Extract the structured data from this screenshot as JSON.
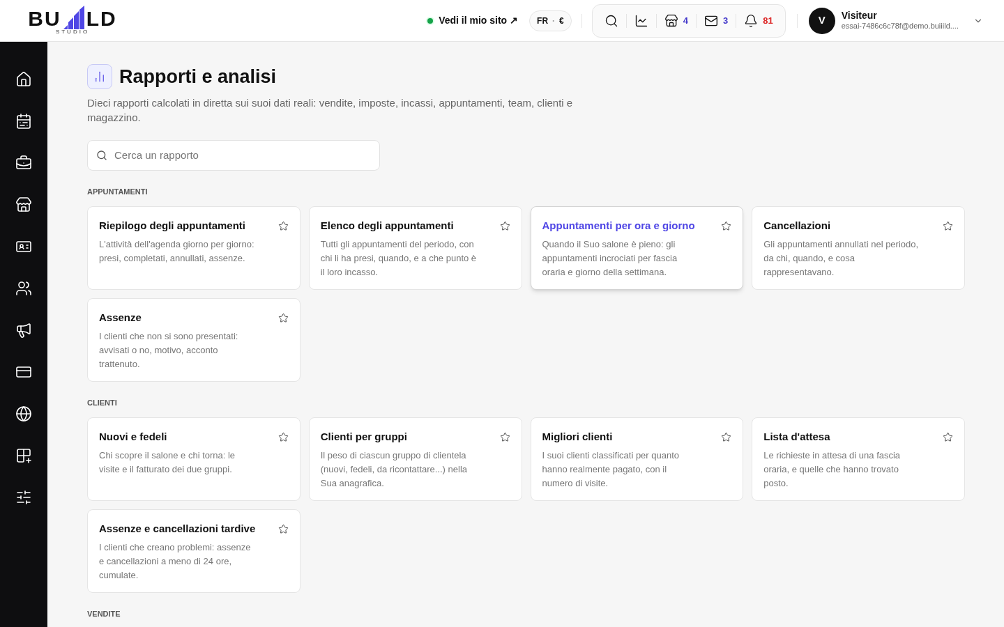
{
  "logo": {
    "left": "BU",
    "right": "LD",
    "sub": "STUDIO"
  },
  "header": {
    "site_link": {
      "label": "Vedi il mio sito ↗",
      "online": true
    },
    "locale": {
      "lang": "FR",
      "sep": "·",
      "currency": "€"
    },
    "tools": [
      {
        "kind": "search"
      },
      {
        "kind": "chart"
      },
      {
        "kind": "store",
        "count": "4",
        "color": "#4338ca"
      },
      {
        "kind": "mail",
        "count": "3",
        "color": "#4338ca"
      },
      {
        "kind": "bell",
        "count": "81",
        "color": "#dc2626"
      }
    ],
    "user": {
      "initial": "V",
      "name": "Visiteur",
      "email": "essai-7486c6c78f@demo.buiiild...."
    }
  },
  "sidebar": {
    "items": [
      {
        "kind": "home"
      },
      {
        "kind": "calendar"
      },
      {
        "kind": "briefcase"
      },
      {
        "kind": "store"
      },
      {
        "kind": "id-card"
      },
      {
        "kind": "users"
      },
      {
        "kind": "megaphone"
      },
      {
        "kind": "card"
      },
      {
        "kind": "globe"
      },
      {
        "kind": "apps"
      },
      {
        "kind": "sliders"
      }
    ]
  },
  "page": {
    "title": "Rapporti e analisi",
    "subtitle": "Dieci rapporti calcolati in diretta sui suoi dati reali: vendite, imposte, incassi, appuntamenti, team, clienti e magazzino.",
    "search": {
      "placeholder": "Cerca un rapporto"
    }
  },
  "sections": [
    {
      "title": "APPUNTAMENTI",
      "cards": [
        {
          "title": "Riepilogo degli appuntamenti",
          "text": "L'attività dell'agenda giorno per giorno: presi, completati, annullati, assenze.",
          "highlighted": false
        },
        {
          "title": "Elenco degli appuntamenti",
          "text": "Tutti gli appuntamenti del periodo, con chi li ha presi, quando, e a che punto è il loro incasso.",
          "highlighted": false
        },
        {
          "title": "Appuntamenti per ora e giorno",
          "text": "Quando il Suo salone è pieno: gli appuntamenti incrociati per fascia oraria e giorno della settimana.",
          "highlighted": true
        },
        {
          "title": "Cancellazioni",
          "text": "Gli appuntamenti annullati nel periodo, da chi, quando, e cosa rappresentavano.",
          "highlighted": false
        },
        {
          "title": "Assenze",
          "text": "I clienti che non si sono presentati: avvisati o no, motivo, acconto trattenuto.",
          "highlighted": false
        }
      ]
    },
    {
      "title": "CLIENTI",
      "cards": [
        {
          "title": "Nuovi e fedeli",
          "text": "Chi scopre il salone e chi torna: le visite e il fatturato dei due gruppi.",
          "highlighted": false
        },
        {
          "title": "Clienti per gruppi",
          "text": "Il peso di ciascun gruppo di clientela (nuovi, fedeli, da ricontattare...) nella Sua anagrafica.",
          "highlighted": false
        },
        {
          "title": "Migliori clienti",
          "text": "I suoi clienti classificati per quanto hanno realmente pagato, con il numero di visite.",
          "highlighted": false
        },
        {
          "title": "Lista d'attesa",
          "text": "Le richieste in attesa di una fascia oraria, e quelle che hanno trovato posto.",
          "highlighted": false
        },
        {
          "title": "Assenze e cancellazioni tardive",
          "text": "I clienti che creano problemi: assenze e cancellazioni a meno di 24 ore, cumulate.",
          "highlighted": false
        }
      ]
    },
    {
      "title": "VENDITE"
    }
  ]
}
